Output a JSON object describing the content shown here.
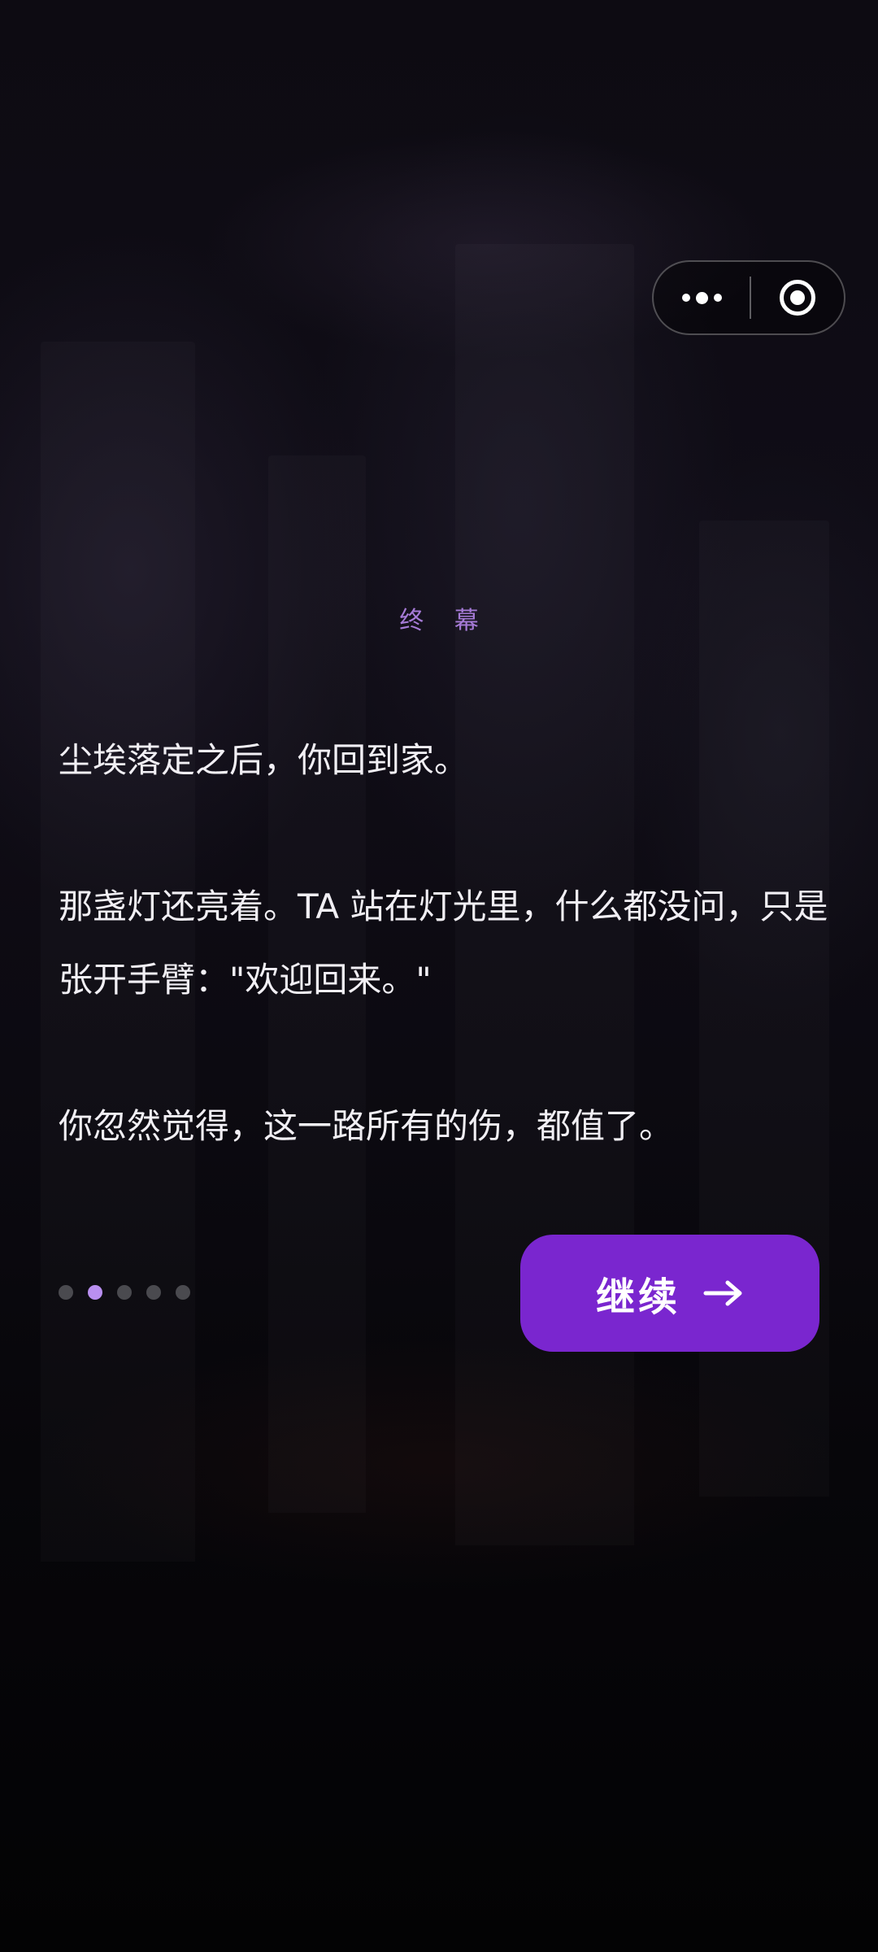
{
  "capsule": {
    "more_icon": "more-dots-icon",
    "close_icon": "target-close-icon"
  },
  "chapter": {
    "title": "终 幕"
  },
  "story": {
    "paragraphs": [
      "尘埃落定之后，你回到家。",
      "那盏灯还亮着。TA 站在灯光里，什么都没问，只是张开手臂：\"欢迎回来。\"",
      "你忽然觉得，这一路所有的伤，都值了。"
    ]
  },
  "pagination": {
    "total": 5,
    "current": 2
  },
  "continue_button": {
    "label": "继续",
    "icon": "arrow-right-icon"
  },
  "colors": {
    "accent": "#7a26cf",
    "chapter_text": "#a57ad6",
    "dot_active": "#b98ff0",
    "dot_inactive": "#4a4a4f"
  }
}
